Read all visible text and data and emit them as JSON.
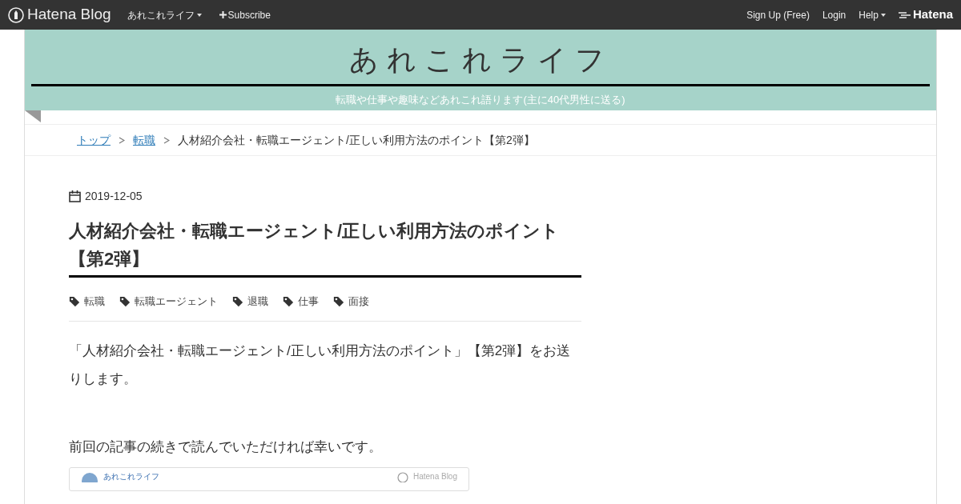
{
  "topbar": {
    "logo": "Hatena Blog",
    "blog_menu": "あれこれライフ",
    "subscribe": "Subscribe",
    "right_links": [
      "Sign Up (Free)",
      "Login"
    ],
    "help": "Help",
    "brand": "Hatena"
  },
  "header": {
    "title": "あれこれライフ",
    "tagline": "転職や仕事や趣味などあれこれ語ります(主に40代男性に送る)"
  },
  "breadcrumb": {
    "links": [
      "トップ",
      "転職"
    ],
    "current": "人材紹介会社・転職エージェント/正しい利用方法のポイント【第2弾】"
  },
  "article": {
    "date": "2019-12-05",
    "title": "人材紹介会社・転職エージェント/正しい利用方法のポイント【第2弾】",
    "tags": [
      "転職",
      "転職エージェント",
      "退職",
      "仕事",
      "面接"
    ],
    "paragraphs": [
      "「人材紹介会社・転職エージェント/正しい利用方法のポイント」【第2弾】をお送りします。",
      "前回の記事の続きで読んでいただければ幸いです。"
    ],
    "embed": {
      "blog_name": "あれこれライフ",
      "service": "Hatena Blog"
    }
  }
}
